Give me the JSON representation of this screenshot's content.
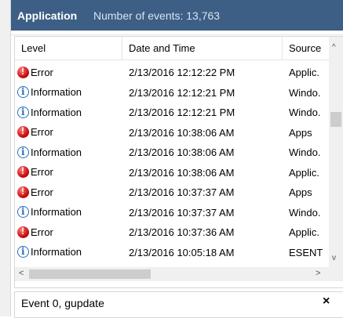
{
  "header": {
    "log_name": "Application",
    "event_count_text": "Number of events: 13,763"
  },
  "columns": {
    "level": "Level",
    "datetime": "Date and Time",
    "source": "Source"
  },
  "rows": [
    {
      "level": "Error",
      "datetime": "2/13/2016 12:12:22 PM",
      "source": "Applic."
    },
    {
      "level": "Information",
      "datetime": "2/13/2016 12:12:21 PM",
      "source": "Windo."
    },
    {
      "level": "Information",
      "datetime": "2/13/2016 12:12:21 PM",
      "source": "Windo."
    },
    {
      "level": "Error",
      "datetime": "2/13/2016 10:38:06 AM",
      "source": "Apps"
    },
    {
      "level": "Information",
      "datetime": "2/13/2016 10:38:06 AM",
      "source": "Windo."
    },
    {
      "level": "Error",
      "datetime": "2/13/2016 10:38:06 AM",
      "source": "Applic."
    },
    {
      "level": "Error",
      "datetime": "2/13/2016 10:37:37 AM",
      "source": "Apps"
    },
    {
      "level": "Information",
      "datetime": "2/13/2016 10:37:37 AM",
      "source": "Windo."
    },
    {
      "level": "Error",
      "datetime": "2/13/2016 10:37:36 AM",
      "source": "Applic."
    },
    {
      "level": "Information",
      "datetime": "2/13/2016 10:05:18 AM",
      "source": "ESENT"
    }
  ],
  "icons": {
    "error": "error-icon",
    "information": "information-icon"
  },
  "colors": {
    "header_bar": "#3d5f86",
    "error": "#c00000",
    "info": "#2b6cc0"
  },
  "detail": {
    "title": "Event 0, gupdate",
    "close_glyph": "×"
  },
  "scroll": {
    "up": "^",
    "down": "v",
    "left": "<",
    "right": ">"
  }
}
